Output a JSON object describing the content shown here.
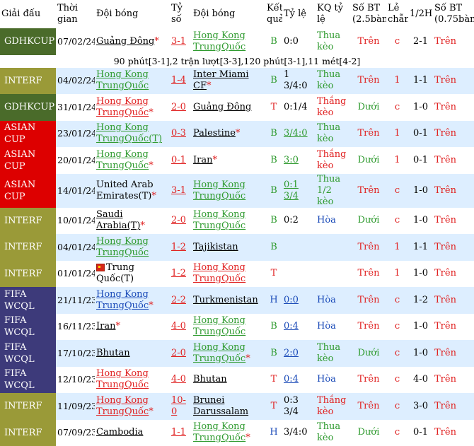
{
  "headers": {
    "league": "Giải đấu",
    "time": "Thời gian",
    "home": "Đội bóng",
    "score": "Tỷ số",
    "away": "Đội bóng",
    "result": "Kết quả",
    "odds": "Tỷ lệ",
    "kq": "KQ tỷ lệ",
    "ou": "Số BT (2.5bàn)",
    "oe": "Lẻ chẵn",
    "half": "1/2H",
    "ou2": "Số BT (0.75bàn)"
  },
  "note": "90 phút[3-1],2 trận lượt[3-3],120 phút[3-1],11 mét[4-2]",
  "colors": {
    "GDHKCUP": "#4a6b2a",
    "INTERF": "#9a9a38",
    "ASIAN": "#dd0000",
    "FIFA": "#3d3a7a"
  },
  "matches": [
    {
      "league": "GDHKCUP",
      "lc": "GDHKCUP",
      "date": "07/02/24",
      "home": "Guảng Đông",
      "home_c": "blk",
      "home_star": "*",
      "score": "3-1",
      "away": "Hong Kong TrungQuốc",
      "away_c": "hk",
      "away_star": "",
      "res": "B",
      "res_c": "b",
      "odds": "0:0",
      "odds_c": "plain",
      "kq": "Thua kèo",
      "kq_c": "green",
      "ou": "Trên",
      "ou_c": "red",
      "oe": "c",
      "half": "2-1",
      "ou2": "Trên",
      "ou2_c": "red"
    },
    {
      "league": "INTERF",
      "lc": "INTERF",
      "date": "04/02/24",
      "home": "Hong Kong TrungQuốc",
      "home_c": "hk",
      "home_star": "",
      "score": "1-4",
      "away": "Inter Miami CF",
      "away_c": "blk",
      "away_star": "*",
      "res": "B",
      "res_c": "b",
      "odds": "1 3/4:0",
      "odds_c": "plain",
      "kq": "Thua kèo",
      "kq_c": "green",
      "ou": "Trên",
      "ou_c": "red",
      "oe": "1",
      "half": "1-1",
      "ou2": "Trên",
      "ou2_c": "red"
    },
    {
      "league": "GDHKCUP",
      "lc": "GDHKCUP",
      "date": "31/01/24",
      "home": "Hong Kong TrungQuốc",
      "home_c": "red",
      "home_star": "*",
      "score": "2-0",
      "away": "Guảng Đông",
      "away_c": "blk",
      "away_star": "",
      "res": "T",
      "res_c": "t",
      "odds": "0:1/4",
      "odds_c": "plain",
      "kq": "Thắng kèo",
      "kq_c": "red",
      "ou": "Dưới",
      "ou_c": "green",
      "oe": "c",
      "half": "1-0",
      "ou2": "Trên",
      "ou2_c": "red"
    },
    {
      "league": "ASIAN CUP",
      "lc": "ASIAN",
      "date": "23/01/24",
      "home": "Hong Kong TrungQuốc(T)",
      "home_c": "hk",
      "home_star": "",
      "score": "0-3",
      "away": "Palestine",
      "away_c": "blk",
      "away_star": "*",
      "res": "B",
      "res_c": "b",
      "odds": "3/4:0",
      "odds_c": "b",
      "kq": "Thua kèo",
      "kq_c": "green",
      "ou": "Trên",
      "ou_c": "red",
      "oe": "1",
      "half": "0-1",
      "ou2": "Trên",
      "ou2_c": "red"
    },
    {
      "league": "ASIAN CUP",
      "lc": "ASIAN",
      "date": "20/01/24",
      "home": "Hong Kong TrungQuốc",
      "home_c": "hk",
      "home_star": "*",
      "score": "0-1",
      "away": "Iran",
      "away_c": "blk",
      "away_star": "*",
      "res": "B",
      "res_c": "b",
      "odds": "3:0",
      "odds_c": "b",
      "kq": "Thắng kèo",
      "kq_c": "red",
      "ou": "Dưới",
      "ou_c": "green",
      "oe": "1",
      "half": "0-1",
      "ou2": "Trên",
      "ou2_c": "red"
    },
    {
      "league": "ASIAN CUP",
      "lc": "ASIAN",
      "date": "14/01/24",
      "home": "United Arab Emirates(T)",
      "home_c": "plain",
      "home_star": "*",
      "score": "3-1",
      "away": "Hong Kong TrungQuốc",
      "away_c": "hk",
      "away_star": "",
      "res": "B",
      "res_c": "b",
      "odds": "0:1 3/4",
      "odds_c": "b",
      "kq": "Thua 1/2 kèo",
      "kq_c": "green",
      "ou": "Trên",
      "ou_c": "red",
      "oe": "c",
      "half": "1-0",
      "ou2": "Trên",
      "ou2_c": "red"
    },
    {
      "league": "INTERF",
      "lc": "INTERF",
      "date": "10/01/24",
      "home": "Saudi Arabia(T)",
      "home_c": "blk",
      "home_star": "*",
      "score": "2-0",
      "away": "Hong Kong TrungQuốc",
      "away_c": "hk",
      "away_star": "",
      "res": "B",
      "res_c": "b",
      "odds": "0:2",
      "odds_c": "plain",
      "kq": "Hòa",
      "kq_c": "blue",
      "ou": "Dưới",
      "ou_c": "green",
      "oe": "c",
      "half": "1-0",
      "ou2": "Trên",
      "ou2_c": "red"
    },
    {
      "league": "INTERF",
      "lc": "INTERF",
      "date": "04/01/24",
      "home": "Hong Kong TrungQuốc",
      "home_c": "hk",
      "home_star": "",
      "score": "1-2",
      "away": "Tajikistan",
      "away_c": "blk",
      "away_star": "",
      "res": "B",
      "res_c": "b",
      "odds": "",
      "odds_c": "plain",
      "kq": "",
      "kq_c": "green",
      "ou": "Trên",
      "ou_c": "red",
      "oe": "1",
      "half": "1-1",
      "ou2": "Trên",
      "ou2_c": "red"
    },
    {
      "league": "INTERF",
      "lc": "INTERF",
      "date": "01/01/24",
      "home": "Trung Quốc(T)",
      "home_c": "flag",
      "home_star": "",
      "score": "1-2",
      "away": "Hong Kong TrungQuốc",
      "away_c": "red",
      "away_star": "",
      "res": "T",
      "res_c": "t",
      "odds": "",
      "odds_c": "plain",
      "kq": "",
      "kq_c": "green",
      "ou": "Trên",
      "ou_c": "red",
      "oe": "1",
      "half": "1-0",
      "ou2": "Trên",
      "ou2_c": "red"
    },
    {
      "league": "FIFA WCQL",
      "lc": "FIFA",
      "date": "21/11/23",
      "home": "Hong Kong TrungQuốc",
      "home_c": "hkblue",
      "home_star": "*",
      "score": "2-2",
      "away": "Turkmenistan",
      "away_c": "blk",
      "away_star": "",
      "res": "H",
      "res_c": "h",
      "odds": "0:0",
      "odds_c": "hu",
      "kq": "Hòa",
      "kq_c": "blue",
      "ou": "Trên",
      "ou_c": "red",
      "oe": "c",
      "half": "1-2",
      "ou2": "Trên",
      "ou2_c": "red"
    },
    {
      "league": "FIFA WCQL",
      "lc": "FIFA",
      "date": "16/11/23",
      "home": "Iran",
      "home_c": "blk",
      "home_star": "*",
      "score": "4-0",
      "away": "Hong Kong TrungQuốc",
      "away_c": "hk",
      "away_star": "",
      "res": "B",
      "res_c": "b",
      "odds": "0:4",
      "odds_c": "hu",
      "kq": "Hòa",
      "kq_c": "blue",
      "ou": "Trên",
      "ou_c": "red",
      "oe": "c",
      "half": "1-0",
      "ou2": "Trên",
      "ou2_c": "red"
    },
    {
      "league": "FIFA WCQL",
      "lc": "FIFA",
      "date": "17/10/23",
      "home": "Bhutan",
      "home_c": "blk",
      "home_star": "",
      "score": "2-0",
      "away": "Hong Kong TrungQuốc",
      "away_c": "hk",
      "away_star": "*",
      "res": "B",
      "res_c": "b",
      "odds": "2:0",
      "odds_c": "hu",
      "kq": "Thua kèo",
      "kq_c": "green",
      "ou": "Dưới",
      "ou_c": "green",
      "oe": "c",
      "half": "1-0",
      "ou2": "Trên",
      "ou2_c": "red"
    },
    {
      "league": "FIFA WCQL",
      "lc": "FIFA",
      "date": "12/10/23",
      "home": "Hong Kong TrungQuốc",
      "home_c": "red",
      "home_star": "",
      "score": "4-0",
      "away": "Bhutan",
      "away_c": "blk",
      "away_star": "",
      "res": "T",
      "res_c": "t",
      "odds": "0:4",
      "odds_c": "hu",
      "kq": "Hòa",
      "kq_c": "blue",
      "ou": "Trên",
      "ou_c": "red",
      "oe": "c",
      "half": "4-0",
      "ou2": "Trên",
      "ou2_c": "red"
    },
    {
      "league": "INTERF",
      "lc": "INTERF",
      "date": "11/09/23",
      "home": "Hong Kong TrungQuốc",
      "home_c": "red",
      "home_star": "*",
      "score": "10-0",
      "away": "Brunei Darussalam",
      "away_c": "blk",
      "away_star": "",
      "res": "T",
      "res_c": "t",
      "odds": "0:3 3/4",
      "odds_c": "plain",
      "kq": "Thắng kèo",
      "kq_c": "red",
      "ou": "Trên",
      "ou_c": "red",
      "oe": "c",
      "half": "3-0",
      "ou2": "Trên",
      "ou2_c": "red"
    },
    {
      "league": "INTERF",
      "lc": "INTERF",
      "date": "07/09/23",
      "home": "Cambodia",
      "home_c": "blk",
      "home_star": "",
      "score": "1-1",
      "away": "Hong Kong TrungQuốc",
      "away_c": "hk",
      "away_star": "*",
      "res": "H",
      "res_c": "h",
      "odds": "3/4:0",
      "odds_c": "plain",
      "kq": "Thua kèo",
      "kq_c": "green",
      "ou": "Dưới",
      "ou_c": "green",
      "oe": "c",
      "half": "0-1",
      "ou2": "Trên",
      "ou2_c": "red"
    }
  ]
}
